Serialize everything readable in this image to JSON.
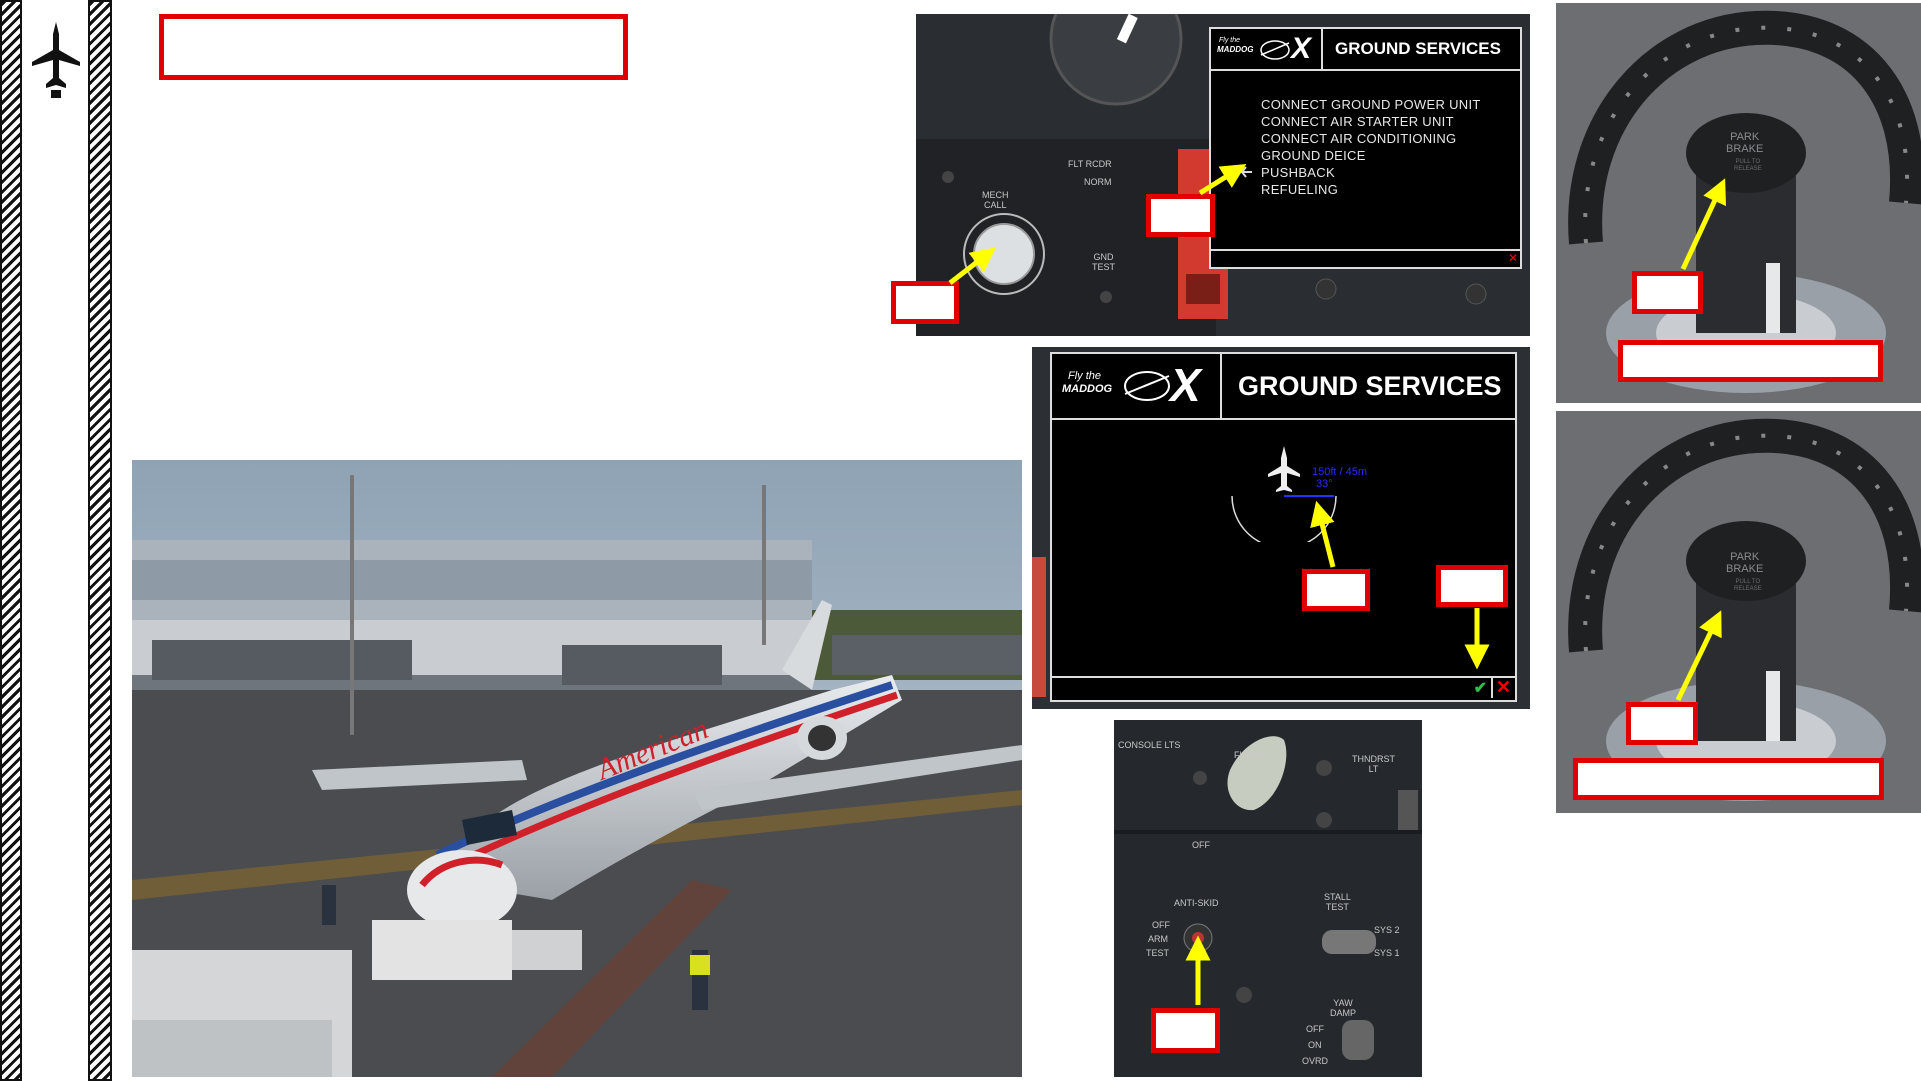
{
  "sidebar": {
    "icon": "airplane-icon"
  },
  "ground_services_small": {
    "logo_small_text": "Fly the",
    "logo_brand": "MADDOG",
    "logo_mark": "X",
    "title": "GROUND SERVICES",
    "menu_items": [
      "CONNECT GROUND POWER UNIT",
      "CONNECT AIR STARTER UNIT",
      "CONNECT AIR CONDITIONING",
      "GROUND DEICE",
      "PUSHBACK",
      "REFUELING"
    ],
    "selected_index": 4
  },
  "mech_panel": {
    "mech_call": "MECH\nCALL",
    "flt_rcdr": "FLT RCDR",
    "norm": "NORM",
    "gnd_test": "GND\nTEST"
  },
  "ground_services_large": {
    "logo_small_text": "Fly the",
    "logo_brand": "MADDOG",
    "logo_mark": "X",
    "title": "GROUND SERVICES",
    "pushback_readout_line1": "150ft / 45m",
    "pushback_readout_line2": "33°",
    "confirm_icon": "checkmark-icon",
    "close_icon": "close-icon"
  },
  "park_brake_top": {
    "label": "PARK\nBRAKE",
    "sub": "PULL TO\nRELEASE"
  },
  "park_brake_bottom": {
    "label": "PARK\nBRAKE",
    "sub": "PULL TO\nRELEASE"
  },
  "console_panel": {
    "console_lts": "CONSOLE LTS",
    "flood": "FLOOD",
    "off": "OFF",
    "thndrst": "THNDRST\nLT",
    "anti_skid": "ANTI-SKID",
    "anti_skid_positions": [
      "OFF",
      "ARM",
      "TEST"
    ],
    "stall_test": "STALL\nTEST",
    "sys2": "SYS 2",
    "sys1": "SYS 1",
    "yaw_damp": "YAW\nDAMP",
    "yaw_positions": [
      "OFF",
      "ON",
      "OVRD"
    ]
  },
  "colors": {
    "callout_red": "#e00000",
    "arrow_yellow": "#ffff00",
    "readout_blue": "#2222ff"
  }
}
